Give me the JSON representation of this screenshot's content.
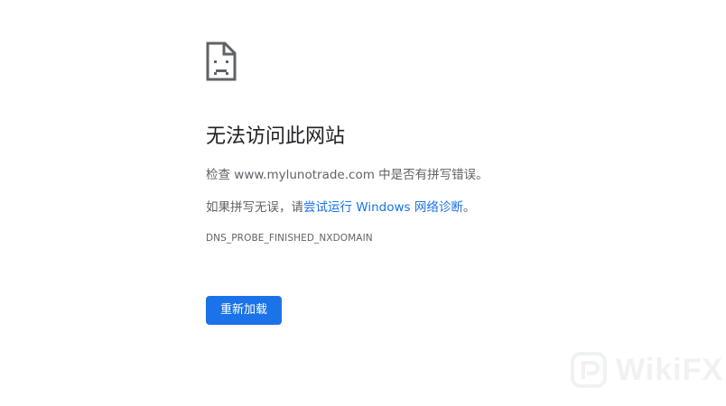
{
  "error_page": {
    "icon": "sad-page-icon",
    "title": "无法访问此网站",
    "check_line": {
      "prefix": "检查 ",
      "domain": "www.mylunotrade.com",
      "suffix": " 中是否有拼写错误。"
    },
    "suggestion_line": {
      "prefix": "如果拼写无误，请",
      "link_text": "尝试运行 Windows 网络诊断",
      "suffix": "。"
    },
    "error_code": "DNS_PROBE_FINISHED_NXDOMAIN",
    "reload_label": "重新加载"
  },
  "watermark": {
    "text": "WikiFX",
    "icon": "wikifx-logo-icon"
  },
  "colors": {
    "accent": "#1a73e8",
    "title_text": "#202124",
    "body_text": "#5f6368",
    "background": "#ffffff"
  }
}
